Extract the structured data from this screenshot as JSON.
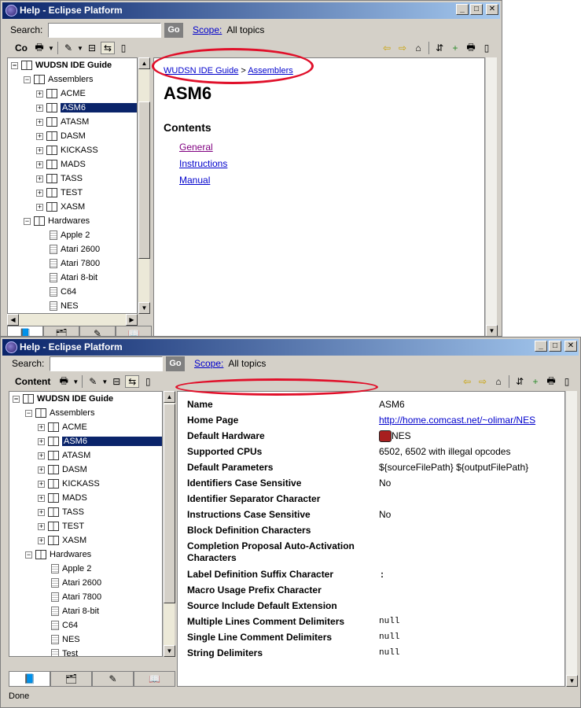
{
  "window1": {
    "title": "Help - Eclipse Platform",
    "search_label": "Search:",
    "search_value": "",
    "go_label": "Go",
    "scope_link": "Scope:",
    "scope_value": "All topics",
    "panel_title": "Co",
    "breadcrumb": {
      "link1": "WUDSN IDE Guide",
      "sep": ">",
      "link2": "Assemblers"
    },
    "page_title": "ASM6",
    "contents_heading": "Contents",
    "content_links": [
      "General",
      "Instructions",
      "Manual"
    ]
  },
  "window2": {
    "title": "Help - Eclipse Platform",
    "search_label": "Search:",
    "search_value": "",
    "go_label": "Go",
    "scope_link": "Scope:",
    "scope_value": "All topics",
    "panel_title": "Content",
    "status": "Done",
    "properties": [
      {
        "key": "Name",
        "value": "ASM6"
      },
      {
        "key": "Home Page",
        "value": "http://home.comcast.net/~olimar/NES"
      },
      {
        "key": "Default Hardware",
        "value": "NES"
      },
      {
        "key": "Supported CPUs",
        "value": "6502, 6502 with illegal opcodes"
      },
      {
        "key": "Default Parameters",
        "value": "${sourceFilePath} ${outputFilePath}"
      },
      {
        "key": "Identifiers Case Sensitive",
        "value": "No"
      },
      {
        "key": "Identifier Separator Character",
        "value": ""
      },
      {
        "key": "Instructions Case Sensitive",
        "value": "No"
      },
      {
        "key": "Block Definition Characters",
        "value": ""
      },
      {
        "key": "Completion Proposal Auto-Activation Characters",
        "value": ""
      },
      {
        "key": "Label Definition Suffix Character",
        "value": ":"
      },
      {
        "key": "Macro Usage Prefix Character",
        "value": ""
      },
      {
        "key": "Source Include Default Extension",
        "value": ""
      },
      {
        "key": "Multiple Lines Comment Delimiters",
        "value": "null"
      },
      {
        "key": "Single Line Comment Delimiters",
        "value": "null"
      },
      {
        "key": "String Delimiters",
        "value": "null"
      }
    ]
  },
  "tree": {
    "root": "WUDSN IDE Guide",
    "assemblers": "Assemblers",
    "assembler_items": [
      "ACME",
      "ASM6",
      "ATASM",
      "DASM",
      "KICKASS",
      "MADS",
      "TASS",
      "TEST",
      "XASM"
    ],
    "hardwares": "Hardwares",
    "hardware_items": [
      "Apple 2",
      "Atari 2600",
      "Atari 7800",
      "Atari 8-bit",
      "C64",
      "NES",
      "Test"
    ]
  },
  "icons": {
    "minimize": "minimize-icon",
    "maximize": "maximize-icon",
    "close": "close-icon",
    "back": "back-arrow-icon",
    "forward": "forward-arrow-icon",
    "home": "home-icon",
    "sync": "sync-toc-icon",
    "bookmark": "bookmark-add-icon",
    "print": "print-icon",
    "maxview": "maximize-view-icon"
  },
  "colors": {
    "titlebar": "#0a246a",
    "selection": "#0a246a",
    "link": "#0000cc",
    "visited_link": "#800080",
    "annotation": "#e0102a"
  }
}
